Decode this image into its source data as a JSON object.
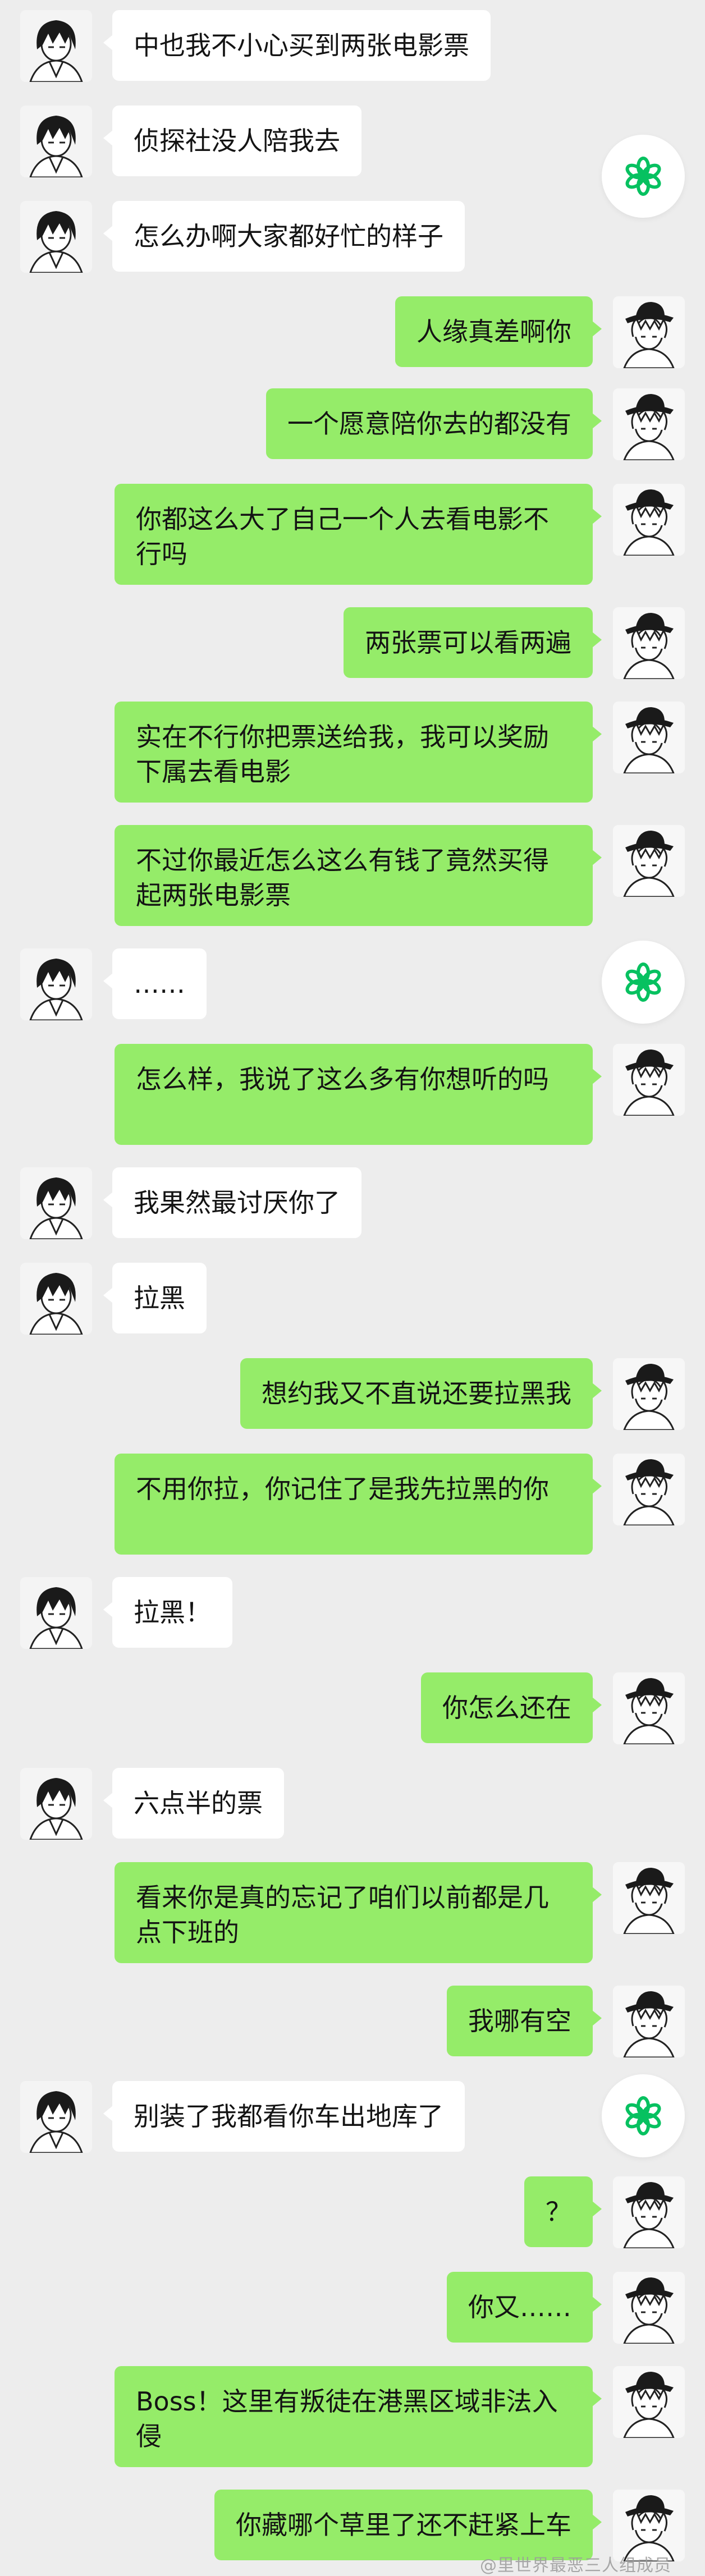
{
  "colors": {
    "background": "#ededed",
    "bubble_left": "#ffffff",
    "bubble_right": "#95ec69",
    "accent_green": "#07c160",
    "text": "#141414"
  },
  "avatars": {
    "left_icon": "dark-haired-boy-avatar-icon",
    "right_icon": "hat-wearing-boy-avatar-icon"
  },
  "float_button_icon": "gear-icon",
  "messages": [
    {
      "side": "left",
      "text": "中也我不小心买到两张电影票"
    },
    {
      "side": "left",
      "text": "侦探社没人陪我去"
    },
    {
      "side": "left",
      "text": "怎么办啊大家都好忙的样子"
    },
    {
      "side": "right",
      "text": "人缘真差啊你"
    },
    {
      "side": "right",
      "text": "一个愿意陪你去的都没有"
    },
    {
      "side": "right",
      "text": "你都这么大了自己一个人去看电影不行吗"
    },
    {
      "side": "right",
      "text": "两张票可以看两遍"
    },
    {
      "side": "right",
      "text": "实在不行你把票送给我，我可以奖励下属去看电影"
    },
    {
      "side": "right",
      "text": "不过你最近怎么这么有钱了竟然买得起两张电影票"
    },
    {
      "side": "left",
      "text": "……"
    },
    {
      "side": "right",
      "text": "怎么样，我说了这么多有你想听的吗"
    },
    {
      "side": "left",
      "text": "我果然最讨厌你了"
    },
    {
      "side": "left",
      "text": "拉黑"
    },
    {
      "side": "right",
      "text": "想约我又不直说还要拉黑我"
    },
    {
      "side": "right",
      "text": "不用你拉，你记住了是我先拉黑的你"
    },
    {
      "side": "left",
      "text": "拉黑！"
    },
    {
      "side": "right",
      "text": "你怎么还在"
    },
    {
      "side": "left",
      "text": "六点半的票"
    },
    {
      "side": "right",
      "text": "看来你是真的忘记了咱们以前都是几点下班的"
    },
    {
      "side": "right",
      "text": "我哪有空"
    },
    {
      "side": "left",
      "text": "别装了我都看你车出地库了"
    },
    {
      "side": "right",
      "text": "？"
    },
    {
      "side": "right",
      "text": "你又……"
    },
    {
      "side": "right",
      "text": "Boss！这里有叛徒在港黑区域非法入侵"
    },
    {
      "side": "right",
      "text": "你藏哪个草里了还不赶紧上车"
    }
  ],
  "watermark": "@里世界最恶三人组成员"
}
